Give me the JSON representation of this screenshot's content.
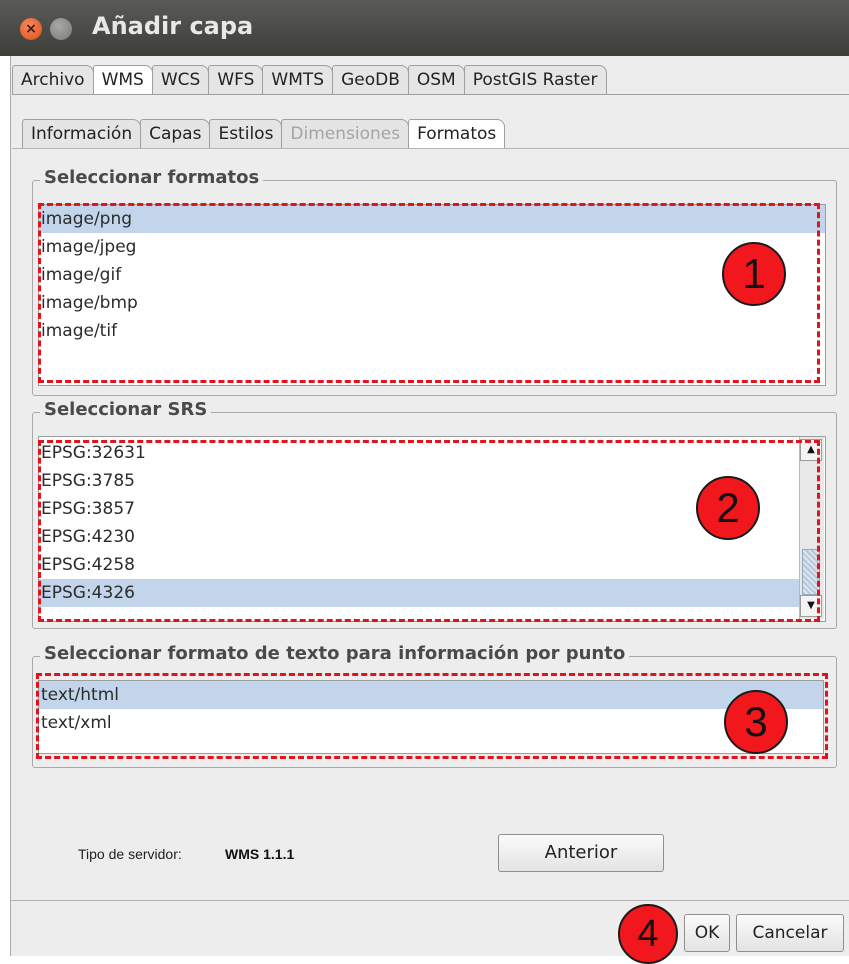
{
  "window": {
    "title": "Añadir capa"
  },
  "tabs_main": [
    {
      "label": "Archivo",
      "active": false,
      "disabled": false
    },
    {
      "label": "WMS",
      "active": true,
      "disabled": false
    },
    {
      "label": "WCS",
      "active": false,
      "disabled": false
    },
    {
      "label": "WFS",
      "active": false,
      "disabled": false
    },
    {
      "label": "WMTS",
      "active": false,
      "disabled": false
    },
    {
      "label": "GeoDB",
      "active": false,
      "disabled": false
    },
    {
      "label": "OSM",
      "active": false,
      "disabled": false
    },
    {
      "label": "PostGIS Raster",
      "active": false,
      "disabled": false
    }
  ],
  "tabs_sub": [
    {
      "label": "Información",
      "active": false,
      "disabled": false
    },
    {
      "label": "Capas",
      "active": false,
      "disabled": false
    },
    {
      "label": "Estilos",
      "active": false,
      "disabled": false
    },
    {
      "label": "Dimensiones",
      "active": false,
      "disabled": true
    },
    {
      "label": "Formatos",
      "active": true,
      "disabled": false
    }
  ],
  "formats": {
    "title": "Seleccionar formatos",
    "items": [
      "image/png",
      "image/jpeg",
      "image/gif",
      "image/bmp",
      "image/tif"
    ],
    "selected_index": 0,
    "badge": "1"
  },
  "srs": {
    "title": "Seleccionar SRS",
    "items": [
      "EPSG:32631",
      "EPSG:3785",
      "EPSG:3857",
      "EPSG:4230",
      "EPSG:4258",
      "EPSG:4326"
    ],
    "selected_index": 5,
    "badge": "2"
  },
  "info_format": {
    "title": "Seleccionar formato de texto para información por punto",
    "items": [
      "text/html",
      "text/xml"
    ],
    "selected_index": 0,
    "badge": "3"
  },
  "footer": {
    "server_label": "Tipo de servidor:",
    "server_value": "WMS 1.1.1",
    "previous_label": "Anterior",
    "ok_label": "OK",
    "cancel_label": "Cancelar",
    "badge": "4"
  },
  "colors": {
    "annotation_red": "#e0141c",
    "selection_blue": "#c3d5ea"
  }
}
